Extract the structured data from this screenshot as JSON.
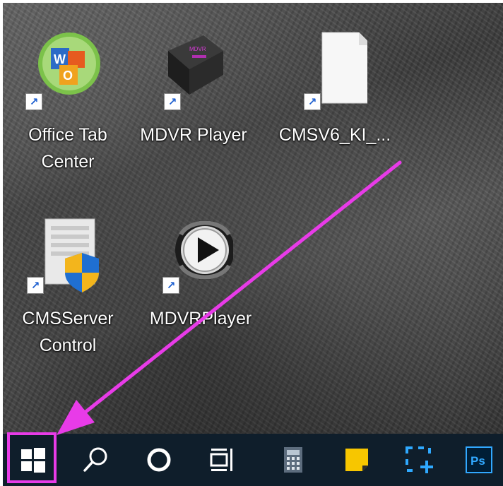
{
  "desktop": {
    "icons": [
      {
        "label_line1": "Office Tab",
        "label_line2": "Center",
        "icon": "office-tab-center-icon"
      },
      {
        "label_line1": "MDVR Player",
        "label_line2": "",
        "icon": "mdvr-device-icon"
      },
      {
        "label_line1": "CMSV6_KI_...",
        "label_line2": "",
        "icon": "blank-file-icon"
      },
      {
        "label_line1": "CMSServer",
        "label_line2": "Control",
        "icon": "cms-server-control-icon"
      },
      {
        "label_line1": "MDVRPlayer",
        "label_line2": "",
        "icon": "media-play-icon"
      }
    ]
  },
  "taskbar": {
    "items": [
      "windows-start-icon",
      "search-icon",
      "cortana-icon",
      "task-view-icon",
      "calculator-icon",
      "sticky-notes-icon",
      "snip-sketch-icon",
      "photoshop-icon"
    ],
    "photoshop_text": "Ps"
  },
  "annotation": {
    "color": "#e83be8"
  }
}
